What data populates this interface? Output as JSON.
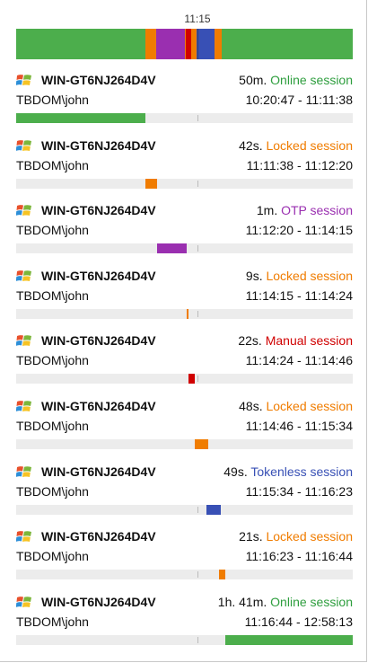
{
  "timeline": {
    "marker_label": "11:15",
    "segments": [
      {
        "color": "#4cae4c",
        "start": 0.0,
        "end": 0.383
      },
      {
        "color": "#f07c00",
        "start": 0.383,
        "end": 0.416
      },
      {
        "color": "#9a2fb0",
        "start": 0.416,
        "end": 0.5
      },
      {
        "color": "#f07c00",
        "start": 0.5,
        "end": 0.505
      },
      {
        "color": "#d00000",
        "start": 0.505,
        "end": 0.52
      },
      {
        "color": "#f07c00",
        "start": 0.52,
        "end": 0.535
      },
      {
        "color": "#3850b5",
        "start": 0.535,
        "end": 0.59
      },
      {
        "color": "#f07c00",
        "start": 0.59,
        "end": 0.61
      },
      {
        "color": "#4cae4c",
        "start": 0.61,
        "end": 1.0
      }
    ]
  },
  "sessions": [
    {
      "host": "WIN-GT6NJ264D4V",
      "user": "TBDOM\\john",
      "duration": "50m.",
      "status": "Online session",
      "status_color": "#2e9e3e",
      "range": "10:20:47 - 11:11:38",
      "bar_color": "#4cae4c",
      "bar_start": 0.0,
      "bar_end": 0.383
    },
    {
      "host": "WIN-GT6NJ264D4V",
      "user": "TBDOM\\john",
      "duration": "42s.",
      "status": "Locked session",
      "status_color": "#f07c00",
      "range": "11:11:38 - 11:12:20",
      "bar_color": "#f07c00",
      "bar_start": 0.383,
      "bar_end": 0.418
    },
    {
      "host": "WIN-GT6NJ264D4V",
      "user": "TBDOM\\john",
      "duration": "1m.",
      "status": "OTP session",
      "status_color": "#9a2fb0",
      "range": "11:12:20 - 11:14:15",
      "bar_color": "#9a2fb0",
      "bar_start": 0.418,
      "bar_end": 0.507
    },
    {
      "host": "WIN-GT6NJ264D4V",
      "user": "TBDOM\\john",
      "duration": "9s.",
      "status": "Locked session",
      "status_color": "#f07c00",
      "range": "11:14:15 - 11:14:24",
      "bar_color": "#f07c00",
      "bar_start": 0.507,
      "bar_end": 0.513
    },
    {
      "host": "WIN-GT6NJ264D4V",
      "user": "TBDOM\\john",
      "duration": "22s.",
      "status": "Manual session",
      "status_color": "#d00000",
      "range": "11:14:24 - 11:14:46",
      "bar_color": "#d00000",
      "bar_start": 0.513,
      "bar_end": 0.531
    },
    {
      "host": "WIN-GT6NJ264D4V",
      "user": "TBDOM\\john",
      "duration": "48s.",
      "status": "Locked session",
      "status_color": "#f07c00",
      "range": "11:14:46 - 11:15:34",
      "bar_color": "#f07c00",
      "bar_start": 0.531,
      "bar_end": 0.57
    },
    {
      "host": "WIN-GT6NJ264D4V",
      "user": "TBDOM\\john",
      "duration": "49s.",
      "status": "Tokenless session",
      "status_color": "#3850b5",
      "range": "11:15:34 - 11:16:23",
      "bar_color": "#3850b5",
      "bar_start": 0.565,
      "bar_end": 0.607
    },
    {
      "host": "WIN-GT6NJ264D4V",
      "user": "TBDOM\\john",
      "duration": "21s.",
      "status": "Locked session",
      "status_color": "#f07c00",
      "range": "11:16:23 - 11:16:44",
      "bar_color": "#f07c00",
      "bar_start": 0.603,
      "bar_end": 0.62
    },
    {
      "host": "WIN-GT6NJ264D4V",
      "user": "TBDOM\\john",
      "duration": "1h. 41m.",
      "status": "Online session",
      "status_color": "#2e9e3e",
      "range": "11:16:44 - 12:58:13",
      "bar_color": "#4cae4c",
      "bar_start": 0.62,
      "bar_end": 1.0
    }
  ]
}
